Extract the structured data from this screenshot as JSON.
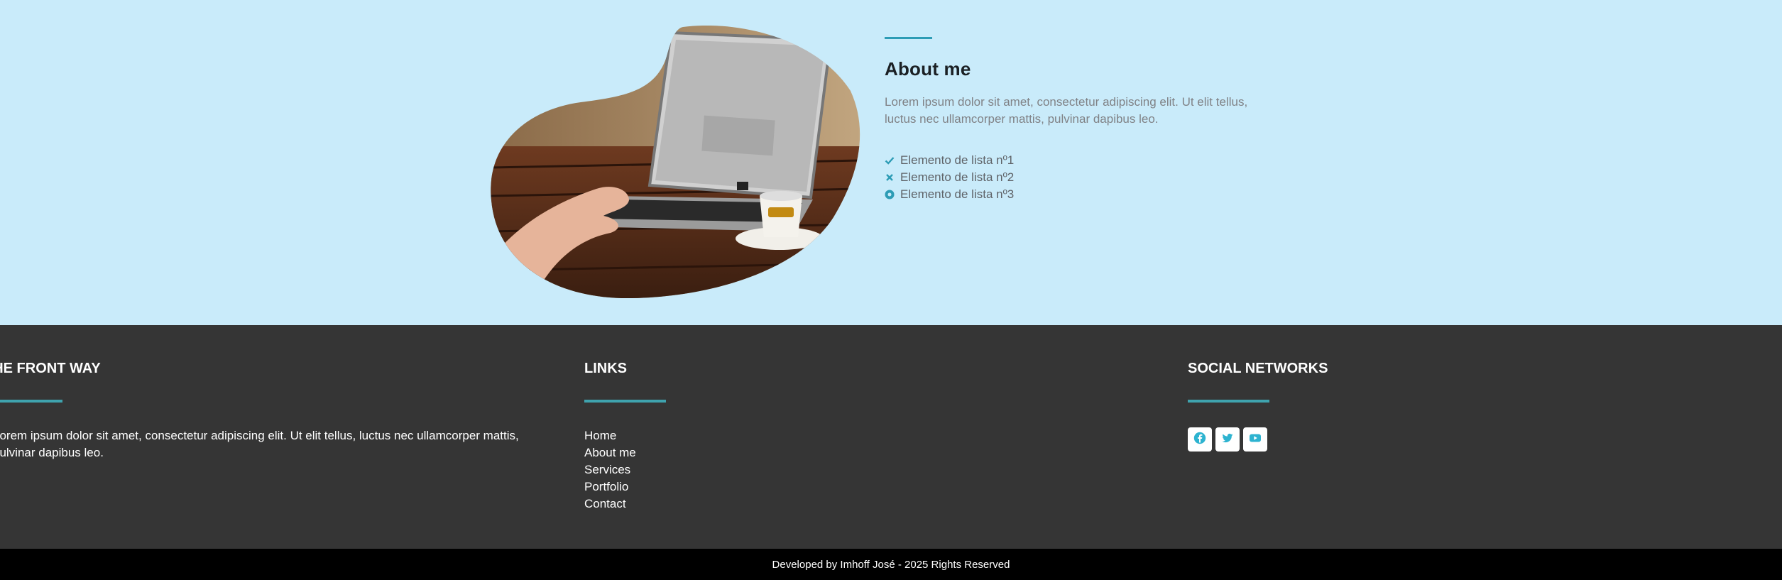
{
  "about": {
    "title": "About me",
    "text": "Lorem ipsum dolor sit amet, consectetur adipiscing elit. Ut elit tellus, luctus nec ullamcorper mattis, pulvinar dapibus leo.",
    "list": [
      {
        "label": "Elemento de lista nº1",
        "icon": "check-icon"
      },
      {
        "label": "Elemento de lista nº2",
        "icon": "times-icon"
      },
      {
        "label": "Elemento de lista nº3",
        "icon": "dot-circle-icon"
      }
    ],
    "accent_color": "#2d9cb5"
  },
  "footer": {
    "brand": {
      "title": "THE FRONT WAY",
      "text": "Lorem ipsum dolor sit amet, consectetur adipiscing elit. Ut elit tellus, luctus nec ullamcorper mattis, pulvinar dapibus leo."
    },
    "links": {
      "title": "LINKS",
      "items": [
        "Home",
        "About me",
        "Services",
        "Portfolio",
        "Contact"
      ]
    },
    "social": {
      "title": "SOCIAL NETWORKS",
      "items": [
        "facebook-icon",
        "twitter-icon",
        "youtube-icon"
      ]
    },
    "accent_color": "#3fa3ae",
    "background": "#353535"
  },
  "bottom_bar": {
    "text": "Developed by Imhoff José - 2025 Rights Reserved"
  }
}
